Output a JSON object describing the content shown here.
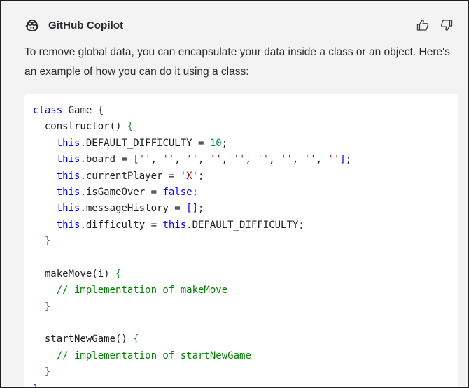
{
  "header": {
    "app_name": "GitHub Copilot",
    "logo_icon": "copilot-icon",
    "thumbs_up_icon": "thumbs-up-icon",
    "thumbs_down_icon": "thumbs-down-icon"
  },
  "message": {
    "text": "To remove global data, you can encapsulate your data inside a class or an object. Here's an example of how you can do it using a class:"
  },
  "code": {
    "language": "javascript",
    "lines": [
      "class Game {",
      "  constructor() {",
      "    this.DEFAULT_DIFFICULTY = 10;",
      "    this.board = ['', '', '', '', '', '', '', '', ''];",
      "    this.currentPlayer = 'X';",
      "    this.isGameOver = false;",
      "    this.messageHistory = [];",
      "    this.difficulty = this.DEFAULT_DIFFICULTY;",
      "  }",
      "",
      "  makeMove(i) {",
      "    // implementation of makeMove",
      "  }",
      "",
      "  startNewGame() {",
      "    // implementation of startNewGame",
      "  }",
      "}"
    ]
  },
  "colors": {
    "keyword": "#0000ff",
    "string": "#a31515",
    "number": "#098658",
    "comment": "#008000",
    "panel_background": "#f3f3f3",
    "code_background": "#ffffff"
  }
}
